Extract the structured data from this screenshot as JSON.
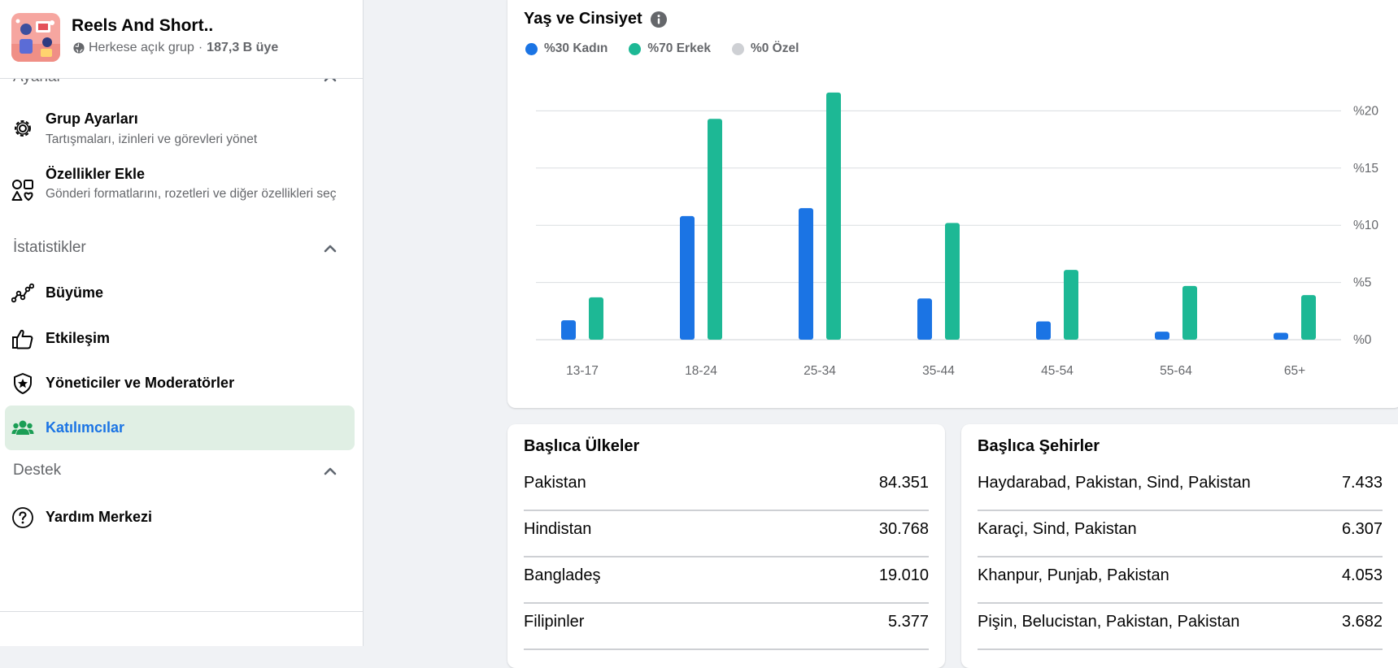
{
  "group": {
    "name": "Reels And Short..",
    "privacy": "Herkese açık grup",
    "separator": "·",
    "members": "187,3 B üye"
  },
  "sidebar": {
    "sections": {
      "ayarlar": "Ayarlar",
      "istatistikler": "İstatistikler",
      "destek": "Destek"
    },
    "items": {
      "grup_ayarlari": {
        "label": "Grup Ayarları",
        "desc": "Tartışmaları, izinleri ve görevleri yönet",
        "icon": "gear-icon"
      },
      "ozellikler_ekle": {
        "label": "Özellikler Ekle",
        "desc": "Gönderi formatlarını, rozetleri ve diğer özellikleri seç",
        "icon": "shapes-icon"
      },
      "buyume": {
        "label": "Büyüme",
        "icon": "growth-line-icon"
      },
      "etkilesim": {
        "label": "Etkileşim",
        "icon": "thumbs-up-icon"
      },
      "yoneticiler": {
        "label": "Yöneticiler ve Moderatörler",
        "icon": "shield-star-icon"
      },
      "katilimcilar": {
        "label": "Katılımcılar",
        "icon": "people-icon",
        "active": true
      },
      "yardim": {
        "label": "Yardım Merkezi",
        "icon": "question-circle-icon"
      }
    }
  },
  "age_gender": {
    "title": "Yaş ve Cinsiyet",
    "legend": [
      {
        "label": "%30 Kadın",
        "color": "#1b74e4"
      },
      {
        "label": "%70 Erkek",
        "color": "#1db895"
      },
      {
        "label": "%0 Özel",
        "color": "#ced0d4"
      }
    ]
  },
  "chart_data": {
    "type": "bar",
    "categories": [
      "13-17",
      "18-24",
      "25-34",
      "35-44",
      "45-54",
      "55-64",
      "65+"
    ],
    "series": [
      {
        "name": "%30 Kadın",
        "color": "#1b74e4",
        "values": [
          1.7,
          10.8,
          11.5,
          3.6,
          1.6,
          0.7,
          0.6
        ]
      },
      {
        "name": "%70 Erkek",
        "color": "#1db895",
        "values": [
          3.7,
          19.3,
          21.6,
          10.2,
          6.1,
          4.7,
          3.9
        ]
      }
    ],
    "y_ticks": [
      "%0",
      "%5",
      "%10",
      "%15",
      "%20"
    ],
    "ylim": [
      0,
      22
    ],
    "y_axis_side": "right",
    "grid": true
  },
  "top_countries": {
    "title": "Başlıca Ülkeler",
    "rows": [
      {
        "name": "Pakistan",
        "value": "84.351"
      },
      {
        "name": "Hindistan",
        "value": "30.768"
      },
      {
        "name": "Bangladeş",
        "value": "19.010"
      },
      {
        "name": "Filipinler",
        "value": "5.377"
      }
    ]
  },
  "top_cities": {
    "title": "Başlıca Şehirler",
    "rows": [
      {
        "name": "Haydarabad, Pakistan, Sind, Pakistan",
        "value": "7.433"
      },
      {
        "name": "Karaçi, Sind, Pakistan",
        "value": "6.307"
      },
      {
        "name": "Khanpur, Punjab, Pakistan",
        "value": "4.053"
      },
      {
        "name": "Pişin, Belucistan, Pakistan, Pakistan",
        "value": "3.682"
      }
    ]
  }
}
